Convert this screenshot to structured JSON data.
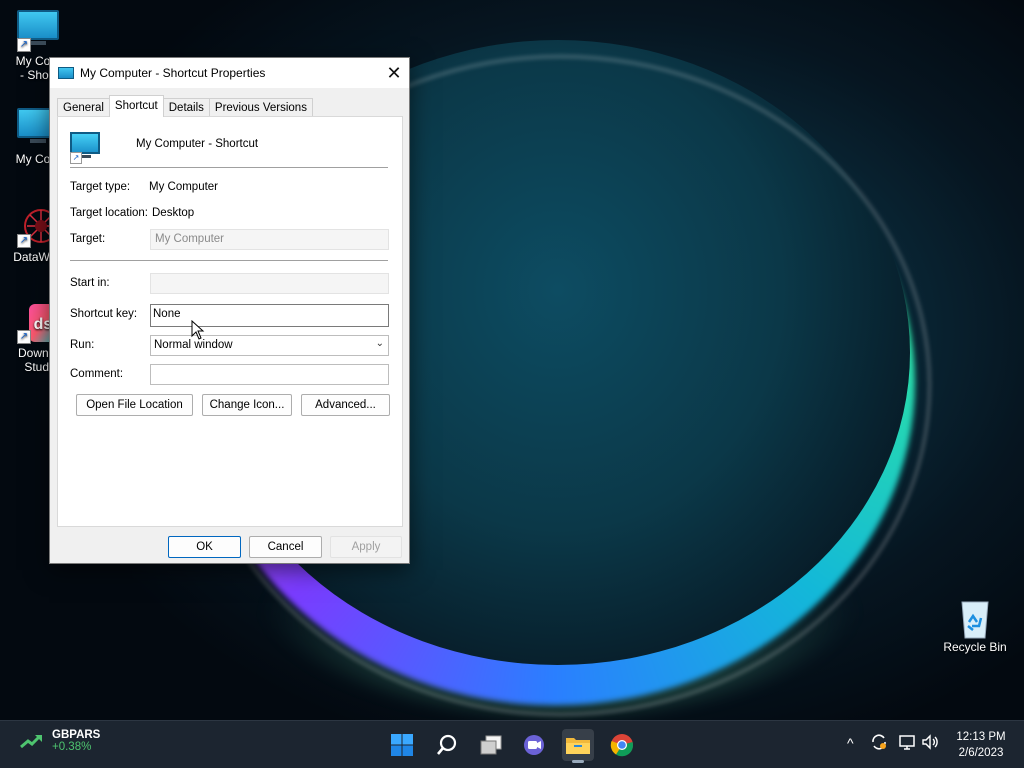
{
  "desktop": {
    "icons": [
      {
        "label_line1": "My Com",
        "label_line2": "- Short"
      },
      {
        "label_line1": "My Com",
        "label_line2": ""
      },
      {
        "label_line1": "DataWag",
        "label_line2": ""
      },
      {
        "label_line1": "Downlo",
        "label_line2": "Studi"
      },
      {
        "label_line1": "Recycle Bin",
        "label_line2": ""
      }
    ]
  },
  "dialog": {
    "title": "My Computer - Shortcut Properties",
    "close_glyph": "✕",
    "tabs": [
      {
        "label": "General"
      },
      {
        "label": "Shortcut"
      },
      {
        "label": "Details"
      },
      {
        "label": "Previous Versions"
      }
    ],
    "active_tab": "Shortcut",
    "shortcut_name": "My Computer - Shortcut",
    "target_type_label": "Target type:",
    "target_type_value": "My Computer",
    "target_location_label": "Target location:",
    "target_location_value": "Desktop",
    "target_label": "Target:",
    "target_value": "My Computer",
    "start_in_label": "Start in:",
    "start_in_value": "",
    "shortcut_key_label": "Shortcut key:",
    "shortcut_key_value": "None",
    "run_label": "Run:",
    "run_value": "Normal window",
    "comment_label": "Comment:",
    "comment_value": "",
    "buttons": {
      "open_file_location": "Open File Location",
      "change_icon": "Change Icon...",
      "advanced": "Advanced...",
      "ok": "OK",
      "cancel": "Cancel",
      "apply": "Apply"
    }
  },
  "taskbar": {
    "widget": {
      "ticker": "GBPARS",
      "change": "+0.38%",
      "change_color": "#4ec46f"
    },
    "apps": [
      "windows-start-icon",
      "search-icon",
      "task-view-icon",
      "teams-chat-icon",
      "file-explorer-icon",
      "chrome-icon"
    ],
    "tray": {
      "chevron": "^"
    },
    "clock": {
      "time": "12:13 PM",
      "date": "2/6/2023"
    }
  }
}
